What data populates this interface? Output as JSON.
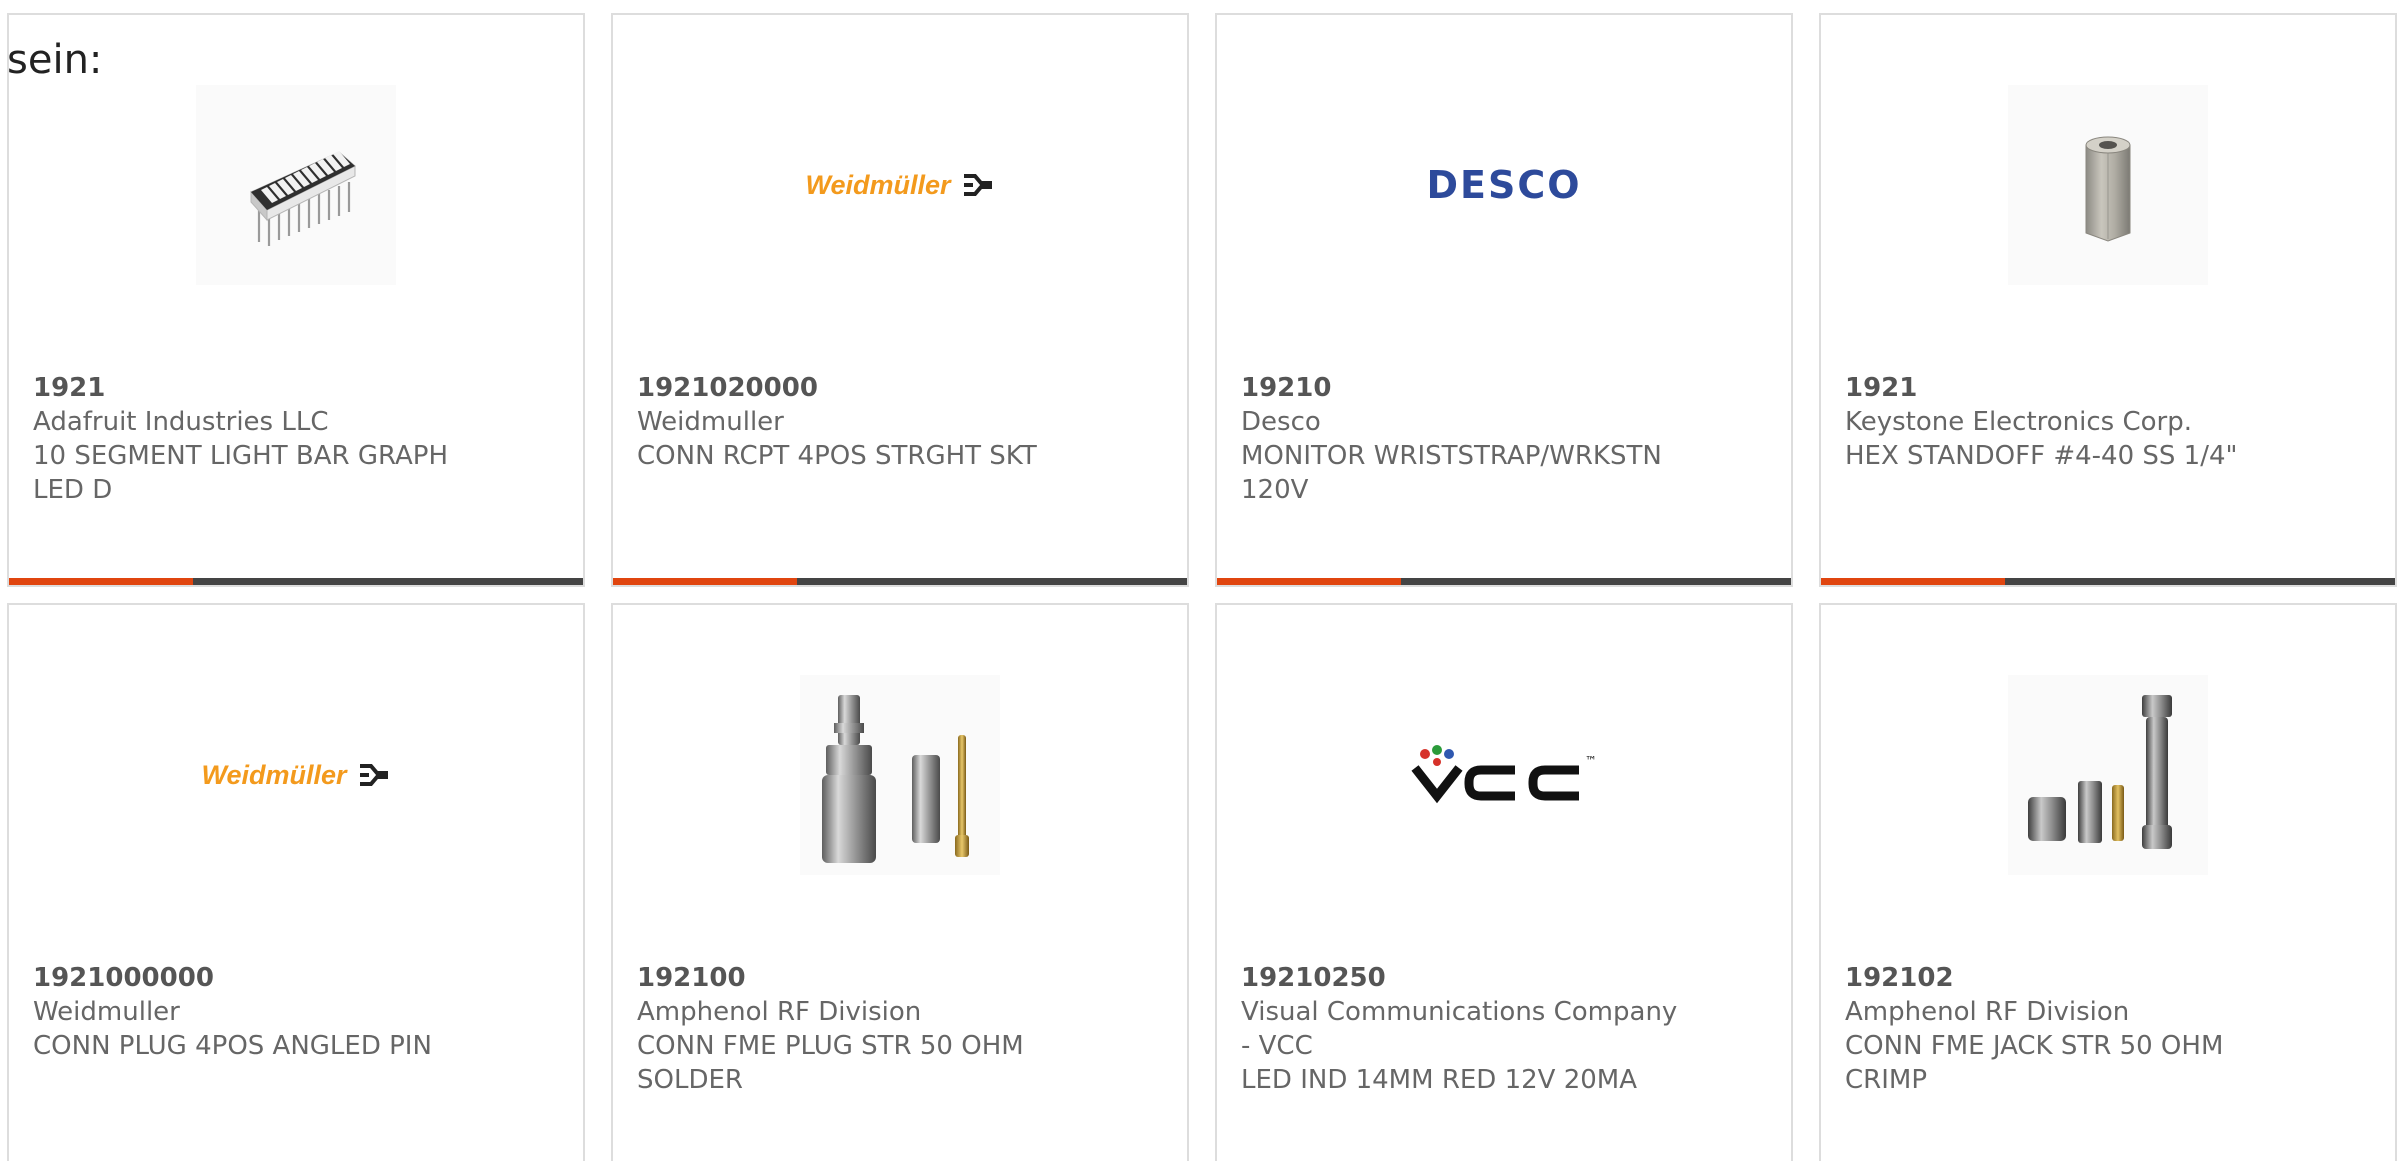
{
  "heading": "sein:",
  "accent_color": "#e0450f",
  "bar_track_color": "#444444",
  "products": [
    {
      "part_number": "1921",
      "manufacturer": "Adafruit Industries LLC",
      "description": "10 SEGMENT LIGHT BAR GRAPH LED D",
      "image": "led-bar-graph-icon",
      "bar_progress": 0.32
    },
    {
      "part_number": "1921020000",
      "manufacturer": "Weidmuller",
      "description": "CONN RCPT 4POS STRGHT SKT",
      "image": "weidmuller-logo",
      "logo_text": "Weidmüller",
      "logo_color": "#f39a1d",
      "bar_progress": 0.32
    },
    {
      "part_number": "19210",
      "manufacturer": "Desco",
      "description": "MONITOR WRISTSTRAP/WRKSTN 120V",
      "image": "desco-logo",
      "logo_text": "DESCO",
      "logo_color": "#2d4a9b",
      "bar_progress": 0.32
    },
    {
      "part_number": "1921",
      "manufacturer": "Keystone Electronics Corp.",
      "description": "HEX STANDOFF #4-40 SS 1/4\"",
      "image": "hex-standoff-icon",
      "bar_progress": 0.32
    },
    {
      "part_number": "1921000000",
      "manufacturer": "Weidmuller",
      "description": "CONN PLUG 4POS ANGLED PIN",
      "image": "weidmuller-logo",
      "logo_text": "Weidmüller",
      "logo_color": "#f39a1d"
    },
    {
      "part_number": "192100",
      "manufacturer": "Amphenol RF Division",
      "description": "CONN FME PLUG STR 50 OHM SOLDER",
      "image": "fme-plug-connector-icon"
    },
    {
      "part_number": "19210250",
      "manufacturer": "Visual Communications Company - VCC",
      "description": "LED IND 14MM RED 12V 20MA",
      "image": "vcc-logo",
      "logo_text": "VCC",
      "logo_tm": "™",
      "logo_color": "#111111"
    },
    {
      "part_number": "192102",
      "manufacturer": "Amphenol RF Division",
      "description": "CONN FME JACK STR 50 OHM CRIMP",
      "image": "fme-jack-connector-icon"
    }
  ]
}
